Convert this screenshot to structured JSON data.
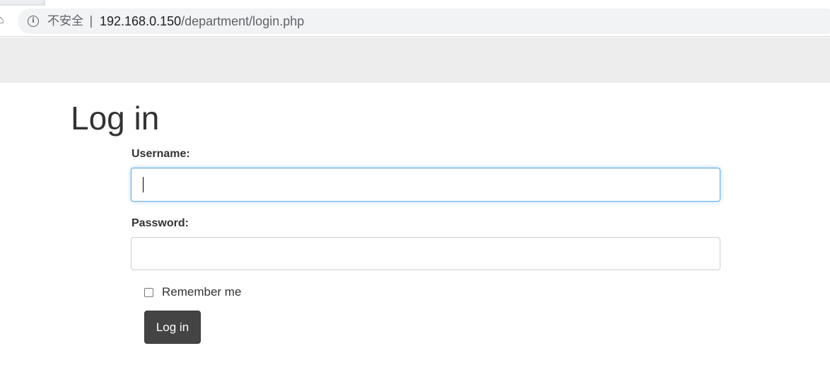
{
  "browser": {
    "security_label": "不安全",
    "separator": "|",
    "url_host": "192.168.0.150",
    "url_path": "/department/login.php",
    "icons": [
      "home-icon",
      "info-icon"
    ]
  },
  "page": {
    "title": "Log in"
  },
  "form": {
    "username_label": "Username:",
    "username_value": "",
    "password_label": "Password:",
    "password_value": "",
    "remember_label": "Remember me",
    "remember_checked": false,
    "submit_label": "Log in"
  },
  "colors": {
    "navbar_bg": "#ededed",
    "button_bg": "#444444",
    "focus_border": "#66afe9",
    "text": "#333333"
  }
}
